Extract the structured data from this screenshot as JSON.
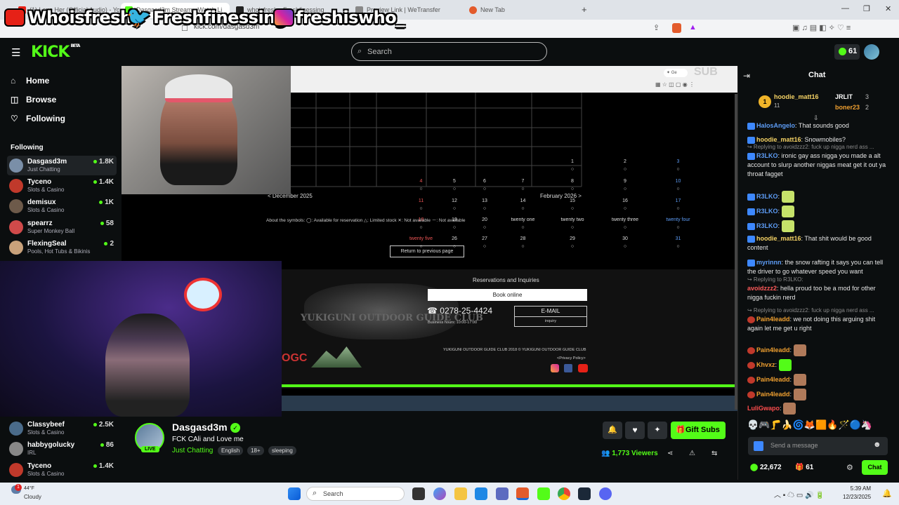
{
  "browser": {
    "tabs": [
      {
        "label": "(1) Love Her (Official Audio) - Yo"
      },
      {
        "label": "Dasgasd3m Stream - Watch Li"
      },
      {
        "label": "whoisfresh - Freshfinessing"
      },
      {
        "label": "Preview Link | WeTransfer"
      },
      {
        "label": "New Tab"
      }
    ],
    "url": "kick.com/dasgasd3m",
    "new_tab": "+"
  },
  "overlay": {
    "youtube": "Whoisfresh",
    "twitter": "Freshfinessing",
    "instagram": "freshiswho_"
  },
  "header": {
    "logo": "KICK",
    "logo_tag": "BETA",
    "search_placeholder": "Search",
    "points": "61"
  },
  "sidebar": {
    "nav": [
      {
        "label": "Home",
        "icon": "home-icon"
      },
      {
        "label": "Browse",
        "icon": "browse-icon"
      },
      {
        "label": "Following",
        "icon": "heart-icon"
      }
    ],
    "following_heading": "Following",
    "following": [
      {
        "name": "Dasgasd3m",
        "category": "Just Chatting",
        "viewers": "1.8K",
        "color": "#7a8fa8"
      },
      {
        "name": "Tyceno",
        "category": "Slots & Casino",
        "viewers": "1.4K",
        "color": "#c0392b"
      },
      {
        "name": "demisux",
        "category": "Slots & Casino",
        "viewers": "1K",
        "color": "#6d5a4a"
      },
      {
        "name": "spearrz",
        "category": "Super Monkey Ball",
        "viewers": "58",
        "color": "#d04a4a"
      },
      {
        "name": "FlexingSeal",
        "category": "Pools, Hot Tubs & Bikinis",
        "viewers": "2",
        "color": "#c9a27b"
      }
    ],
    "recommended": [
      {
        "name": "Classybeef",
        "category": "Slots & Casino",
        "viewers": "2.5K",
        "color": "#4a6b8a"
      },
      {
        "name": "habbygolucky",
        "category": "IRL",
        "viewers": "86",
        "color": "#888"
      },
      {
        "name": "Tyceno",
        "category": "Slots & Casino",
        "viewers": "1.4K",
        "color": "#c0392b"
      }
    ]
  },
  "video": {
    "calendar_rows": [
      [
        "",
        "",
        "",
        "1",
        "2",
        "3"
      ],
      [
        "4",
        "5",
        "6",
        "7",
        "8",
        "9",
        "10"
      ],
      [
        "11",
        "12",
        "13",
        "14",
        "15",
        "16",
        "17"
      ],
      [
        "18",
        "19",
        "20",
        "twenty one",
        "twenty two",
        "twenty three",
        "twenty four"
      ],
      [
        "twenty five",
        "26",
        "27",
        "28",
        "29",
        "30",
        "31"
      ]
    ],
    "prev_month": "< December 2025",
    "next_month": "February 2026 >",
    "symbols": "About the symbols: ◯: Available for reservation △: Limited stock ✕: Not available －: Not available",
    "return_btn": "Return to previous page",
    "reservations": "Reservations and Inquiries",
    "book_online": "Book online",
    "phone": "☎ 0278-25-4424",
    "hours": "Business hours: 10:00-17:00",
    "email": "E-MAIL",
    "inquiry": "inquiry",
    "club": "YUKIGUNI OUTDOOR GUIDE CLUB",
    "copyright": "YUKIGUNI OUTDOOR GUIDE CLUB 2018 ©  YUKIGUNI OUTDOOR GUIDE CLUB",
    "privacy": "<Privacy Policy>",
    "sub_text": "SUB",
    "logo_text": "OGC"
  },
  "stream": {
    "name": "Dasgasd3m",
    "title": "FCK CAli and Love me",
    "category": "Just Chatting",
    "tags": [
      "English",
      "18+",
      "sleeping"
    ],
    "live": "LIVE",
    "viewers": "1,773 Viewers",
    "gift_subs": "Gift Subs"
  },
  "chat": {
    "title": "Chat",
    "top": [
      {
        "rank": "1",
        "name": "hoodie_matt16",
        "count": "11"
      },
      {
        "name": "JRLIT",
        "count": "3"
      },
      {
        "name": "boner23",
        "count": "2"
      }
    ],
    "messages": [
      {
        "user": "HalosAngelo",
        "color": "#5d9cf5",
        "text": ": That sounds good"
      },
      {
        "user": "hoodie_matt16",
        "color": "#f6d365",
        "text": ": Snowmobiles?"
      },
      {
        "reply": "Replying to avoidzzz2: fuck up nigga nerd ass ...",
        "user": "R3LKO",
        "color": "#5d9cf5",
        "text": ": ironic gay ass nigga you made a alt account to slurp another niggas meat get it out ya throat fagget"
      },
      {
        "user": "R3LKO",
        "color": "#5d9cf5",
        "text": ":"
      },
      {
        "user": "R3LKO",
        "color": "#5d9cf5",
        "text": ":"
      },
      {
        "user": "R3LKO",
        "color": "#5d9cf5",
        "text": ":"
      },
      {
        "user": "hoodie_matt16",
        "color": "#f6d365",
        "text": ": That shit would be good content"
      },
      {
        "user": "myrinnn",
        "color": "#5d9cf5",
        "text": ": the snow rafting it says you can tell the driver to go whatever speed you want"
      },
      {
        "reply": "Replying to R3LKO:",
        "user": "avoidzzz2",
        "color": "#ff5a5a",
        "text": ": hella proud too be a mod for other nigga fuckin nerd"
      },
      {
        "reply": "Replying to avoidzzz2: fuck up nigga nerd ass ...",
        "user": "Pain4leadd",
        "color": "#f0a030",
        "text": ": we not doing this arguing shit again let me get u right"
      },
      {
        "user": "Pain4leadd",
        "color": "#f0a030",
        "text": ":"
      },
      {
        "user": "Khvxz",
        "color": "#f0a030",
        "text": ":"
      },
      {
        "user": "Pain4leadd",
        "color": "#f0a030",
        "text": ":"
      },
      {
        "user": "Pain4leadd",
        "color": "#f0a030",
        "text": ":"
      },
      {
        "user": "LuliGwapo",
        "color": "#ff4d4d",
        "text": ":"
      }
    ],
    "input_placeholder": "Send a message",
    "points": "22,672",
    "subs": "61",
    "chat_btn": "Chat"
  },
  "taskbar": {
    "weather_temp": "44°F",
    "weather_desc": "Cloudy",
    "search": "Search",
    "time": "5:39 AM",
    "date": "12/23/2025",
    "notif": "1"
  }
}
